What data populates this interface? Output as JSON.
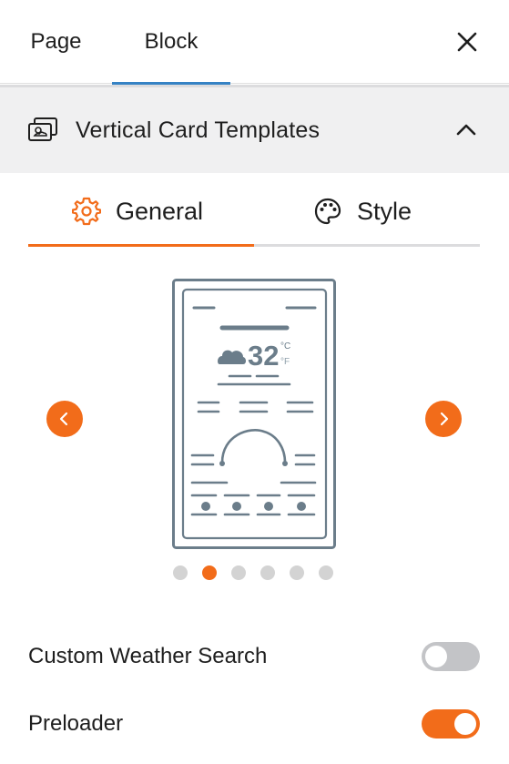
{
  "tabs": {
    "page": "Page",
    "block": "Block"
  },
  "panel": {
    "title": "Vertical Card Templates"
  },
  "subtabs": {
    "general": "General",
    "style": "Style"
  },
  "preview": {
    "temperature": "32",
    "unit_c": "°C",
    "unit_f": "°F"
  },
  "carousel": {
    "total": 6,
    "active_index": 1
  },
  "settings": [
    {
      "label": "Custom Weather Search",
      "enabled": false
    },
    {
      "label": "Preloader",
      "enabled": true
    }
  ],
  "colors": {
    "accent": "#f26c1a",
    "tab_active": "#3582c4",
    "toggle_off": "#c3c4c7",
    "preview_stroke": "#6b7d8a"
  },
  "icons": {
    "close": "close-icon",
    "collapse": "chevron-up-icon",
    "general": "gear-icon",
    "style": "palette-icon",
    "prev": "chevron-left-icon",
    "next": "chevron-right-icon"
  }
}
